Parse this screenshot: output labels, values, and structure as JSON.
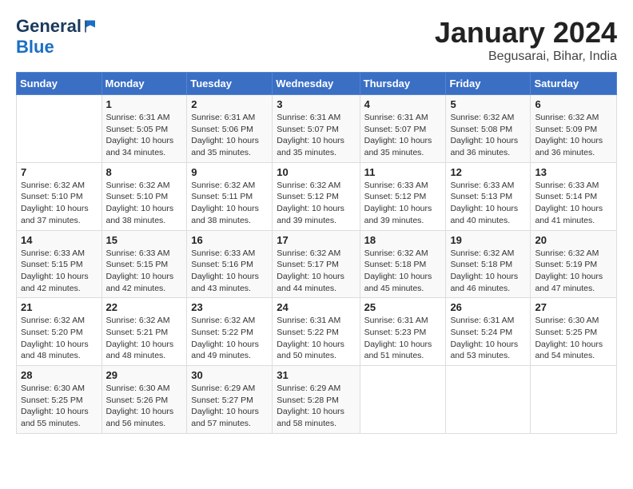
{
  "logo": {
    "general": "General",
    "blue": "Blue"
  },
  "header": {
    "title": "January 2024",
    "subtitle": "Begusarai, Bihar, India"
  },
  "weekdays": [
    "Sunday",
    "Monday",
    "Tuesday",
    "Wednesday",
    "Thursday",
    "Friday",
    "Saturday"
  ],
  "weeks": [
    [
      {
        "day": "",
        "info": ""
      },
      {
        "day": "1",
        "info": "Sunrise: 6:31 AM\nSunset: 5:05 PM\nDaylight: 10 hours\nand 34 minutes."
      },
      {
        "day": "2",
        "info": "Sunrise: 6:31 AM\nSunset: 5:06 PM\nDaylight: 10 hours\nand 35 minutes."
      },
      {
        "day": "3",
        "info": "Sunrise: 6:31 AM\nSunset: 5:07 PM\nDaylight: 10 hours\nand 35 minutes."
      },
      {
        "day": "4",
        "info": "Sunrise: 6:31 AM\nSunset: 5:07 PM\nDaylight: 10 hours\nand 35 minutes."
      },
      {
        "day": "5",
        "info": "Sunrise: 6:32 AM\nSunset: 5:08 PM\nDaylight: 10 hours\nand 36 minutes."
      },
      {
        "day": "6",
        "info": "Sunrise: 6:32 AM\nSunset: 5:09 PM\nDaylight: 10 hours\nand 36 minutes."
      }
    ],
    [
      {
        "day": "7",
        "info": "Sunrise: 6:32 AM\nSunset: 5:10 PM\nDaylight: 10 hours\nand 37 minutes."
      },
      {
        "day": "8",
        "info": "Sunrise: 6:32 AM\nSunset: 5:10 PM\nDaylight: 10 hours\nand 38 minutes."
      },
      {
        "day": "9",
        "info": "Sunrise: 6:32 AM\nSunset: 5:11 PM\nDaylight: 10 hours\nand 38 minutes."
      },
      {
        "day": "10",
        "info": "Sunrise: 6:32 AM\nSunset: 5:12 PM\nDaylight: 10 hours\nand 39 minutes."
      },
      {
        "day": "11",
        "info": "Sunrise: 6:33 AM\nSunset: 5:12 PM\nDaylight: 10 hours\nand 39 minutes."
      },
      {
        "day": "12",
        "info": "Sunrise: 6:33 AM\nSunset: 5:13 PM\nDaylight: 10 hours\nand 40 minutes."
      },
      {
        "day": "13",
        "info": "Sunrise: 6:33 AM\nSunset: 5:14 PM\nDaylight: 10 hours\nand 41 minutes."
      }
    ],
    [
      {
        "day": "14",
        "info": "Sunrise: 6:33 AM\nSunset: 5:15 PM\nDaylight: 10 hours\nand 42 minutes."
      },
      {
        "day": "15",
        "info": "Sunrise: 6:33 AM\nSunset: 5:15 PM\nDaylight: 10 hours\nand 42 minutes."
      },
      {
        "day": "16",
        "info": "Sunrise: 6:33 AM\nSunset: 5:16 PM\nDaylight: 10 hours\nand 43 minutes."
      },
      {
        "day": "17",
        "info": "Sunrise: 6:32 AM\nSunset: 5:17 PM\nDaylight: 10 hours\nand 44 minutes."
      },
      {
        "day": "18",
        "info": "Sunrise: 6:32 AM\nSunset: 5:18 PM\nDaylight: 10 hours\nand 45 minutes."
      },
      {
        "day": "19",
        "info": "Sunrise: 6:32 AM\nSunset: 5:18 PM\nDaylight: 10 hours\nand 46 minutes."
      },
      {
        "day": "20",
        "info": "Sunrise: 6:32 AM\nSunset: 5:19 PM\nDaylight: 10 hours\nand 47 minutes."
      }
    ],
    [
      {
        "day": "21",
        "info": "Sunrise: 6:32 AM\nSunset: 5:20 PM\nDaylight: 10 hours\nand 48 minutes."
      },
      {
        "day": "22",
        "info": "Sunrise: 6:32 AM\nSunset: 5:21 PM\nDaylight: 10 hours\nand 48 minutes."
      },
      {
        "day": "23",
        "info": "Sunrise: 6:32 AM\nSunset: 5:22 PM\nDaylight: 10 hours\nand 49 minutes."
      },
      {
        "day": "24",
        "info": "Sunrise: 6:31 AM\nSunset: 5:22 PM\nDaylight: 10 hours\nand 50 minutes."
      },
      {
        "day": "25",
        "info": "Sunrise: 6:31 AM\nSunset: 5:23 PM\nDaylight: 10 hours\nand 51 minutes."
      },
      {
        "day": "26",
        "info": "Sunrise: 6:31 AM\nSunset: 5:24 PM\nDaylight: 10 hours\nand 53 minutes."
      },
      {
        "day": "27",
        "info": "Sunrise: 6:30 AM\nSunset: 5:25 PM\nDaylight: 10 hours\nand 54 minutes."
      }
    ],
    [
      {
        "day": "28",
        "info": "Sunrise: 6:30 AM\nSunset: 5:25 PM\nDaylight: 10 hours\nand 55 minutes."
      },
      {
        "day": "29",
        "info": "Sunrise: 6:30 AM\nSunset: 5:26 PM\nDaylight: 10 hours\nand 56 minutes."
      },
      {
        "day": "30",
        "info": "Sunrise: 6:29 AM\nSunset: 5:27 PM\nDaylight: 10 hours\nand 57 minutes."
      },
      {
        "day": "31",
        "info": "Sunrise: 6:29 AM\nSunset: 5:28 PM\nDaylight: 10 hours\nand 58 minutes."
      },
      {
        "day": "",
        "info": ""
      },
      {
        "day": "",
        "info": ""
      },
      {
        "day": "",
        "info": ""
      }
    ]
  ]
}
